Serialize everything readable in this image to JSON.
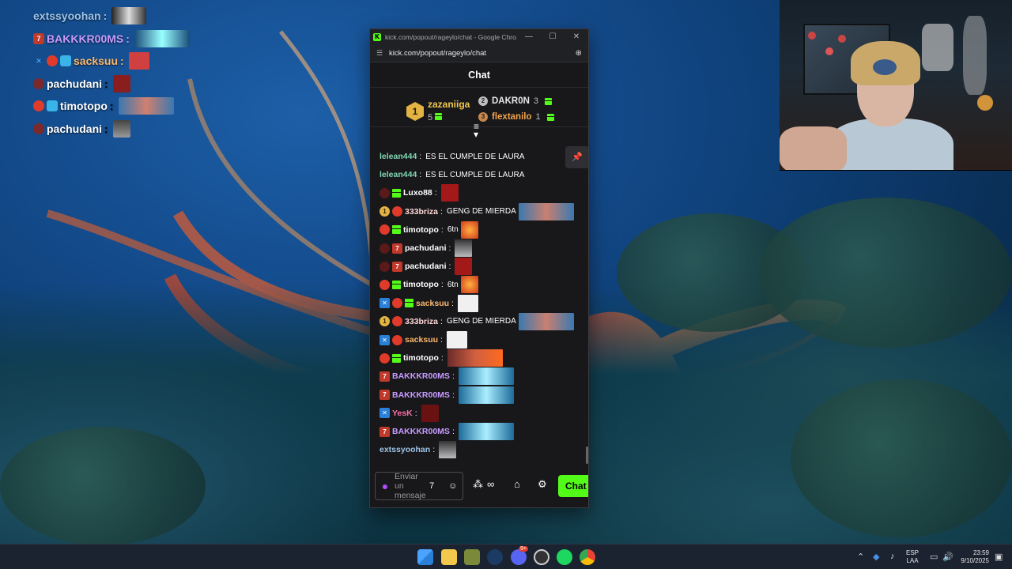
{
  "overlay_chat": [
    {
      "name": "extssyoohan",
      "color": "#9ec3e6",
      "badges": []
    },
    {
      "name": "BAKKKR00MS",
      "color": "#c79bff",
      "badges": [
        "7tv"
      ]
    },
    {
      "name": "sacksuu",
      "color": "#ffb86b",
      "badges": [
        "sword",
        "red",
        "cube"
      ]
    },
    {
      "name": "pachudani",
      "color": "#ffffff",
      "badges": [
        "skull"
      ]
    },
    {
      "name": "timotopo",
      "color": "#ffffff",
      "badges": [
        "red",
        "cube"
      ]
    },
    {
      "name": "pachudani",
      "color": "#ffffff",
      "badges": [
        "skull"
      ]
    }
  ],
  "browser": {
    "title": "kick.com/popout/rageylo/chat - Google Chro...",
    "url": "kick.com/popout/rageylo/chat"
  },
  "chat": {
    "header": "Chat",
    "leaderboard": {
      "first": {
        "rank": "1",
        "name": "zazaniiga",
        "count": "5"
      },
      "second": {
        "rank": "2",
        "name": "DAKR0N",
        "count": "3"
      },
      "third": {
        "rank": "3",
        "name": "flextanilo",
        "count": "1"
      }
    },
    "messages": [
      {
        "user": "lelean444",
        "color": "#7fd6b0",
        "text": "ES EL CUMPLE DE LAURA",
        "badges": []
      },
      {
        "user": "lelean444",
        "color": "#7fd6b0",
        "text": "ES EL CUMPLE DE LAURA",
        "badges": []
      },
      {
        "user": "Luxo88",
        "color": "#ffffff",
        "text": "",
        "badges": [
          "skull",
          "gift"
        ],
        "emote": "red-face"
      },
      {
        "user": "333briza",
        "color": "#ffd6d6",
        "text": "GENG DE MIERDA",
        "badges": [
          "one",
          "red"
        ],
        "emote": "photo"
      },
      {
        "user": "timotopo",
        "color": "#ffffff",
        "text": "6tn",
        "badges": [
          "red",
          "gift"
        ],
        "emote": "fire"
      },
      {
        "user": "pachudani",
        "color": "#ffffff",
        "text": "",
        "badges": [
          "skull",
          "7tv"
        ],
        "emote": "grey-face"
      },
      {
        "user": "pachudani",
        "color": "#ffffff",
        "text": "",
        "badges": [
          "skull",
          "7tv"
        ],
        "emote": "red-face"
      },
      {
        "user": "timotopo",
        "color": "#ffffff",
        "text": "6tn",
        "badges": [
          "red",
          "gift"
        ],
        "emote": "fire"
      },
      {
        "user": "sacksuu",
        "color": "#ffb86b",
        "text": "",
        "badges": [
          "sword",
          "red",
          "gift"
        ],
        "emote": "ghost"
      },
      {
        "user": "333briza",
        "color": "#ffd6d6",
        "text": "GENG DE MIERDA",
        "badges": [
          "one",
          "red"
        ],
        "emote": "photo"
      },
      {
        "user": "sacksuu",
        "color": "#ffb86b",
        "text": "",
        "badges": [
          "sword",
          "red"
        ],
        "emote": "ghost"
      },
      {
        "user": "timotopo",
        "color": "#ffffff",
        "text": "",
        "badges": [
          "red",
          "gift"
        ],
        "emote": "wide-photo"
      },
      {
        "user": "BAKKKR00MS",
        "color": "#c79bff",
        "text": "",
        "badges": [
          "7tv"
        ],
        "emote": "cyan"
      },
      {
        "user": "BAKKKR00MS",
        "color": "#c79bff",
        "text": "",
        "badges": [
          "7tv"
        ],
        "emote": "cyan"
      },
      {
        "user": "YesK",
        "color": "#ff6fa8",
        "text": "",
        "badges": [
          "sword"
        ],
        "emote": "dark-red"
      },
      {
        "user": "BAKKKR00MS",
        "color": "#c79bff",
        "text": "",
        "badges": [
          "7tv"
        ],
        "emote": "cyan"
      },
      {
        "user": "extssyoohan",
        "color": "#9ec3e6",
        "text": "",
        "badges": [],
        "emote": "grey-face"
      }
    ],
    "composer_placeholder": "Enviar un mensaje",
    "send_label": "Chat"
  },
  "taskbar": {
    "lang_top": "ESP",
    "lang_bottom": "LAA",
    "time": "23:59",
    "date": "9/10/2025",
    "discord_badge": "9+"
  },
  "colors": {
    "kick_green": "#53fc18",
    "chat_bg": "#18181b"
  }
}
